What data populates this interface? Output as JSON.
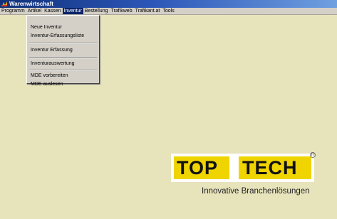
{
  "window": {
    "title": "Warenwirtschaft"
  },
  "menubar": {
    "items": [
      "Programm",
      "Artikel",
      "Kassen",
      "Inventur",
      "Bestellung",
      "Trafikweb",
      "Trafikant.at",
      "Tools"
    ],
    "active": "Inventur"
  },
  "inventur_menu": {
    "items": [
      "Neue Inventur",
      "Inventur-Erfassungsliste",
      "Inventur Erfassung",
      "Inventurauswertung",
      "MDE vorbereiten",
      "MDE auslesen"
    ]
  },
  "logo": {
    "word1": "TOP",
    "word2": "TECH",
    "registered": "R",
    "tagline": "Innovative Branchenlösungen"
  }
}
